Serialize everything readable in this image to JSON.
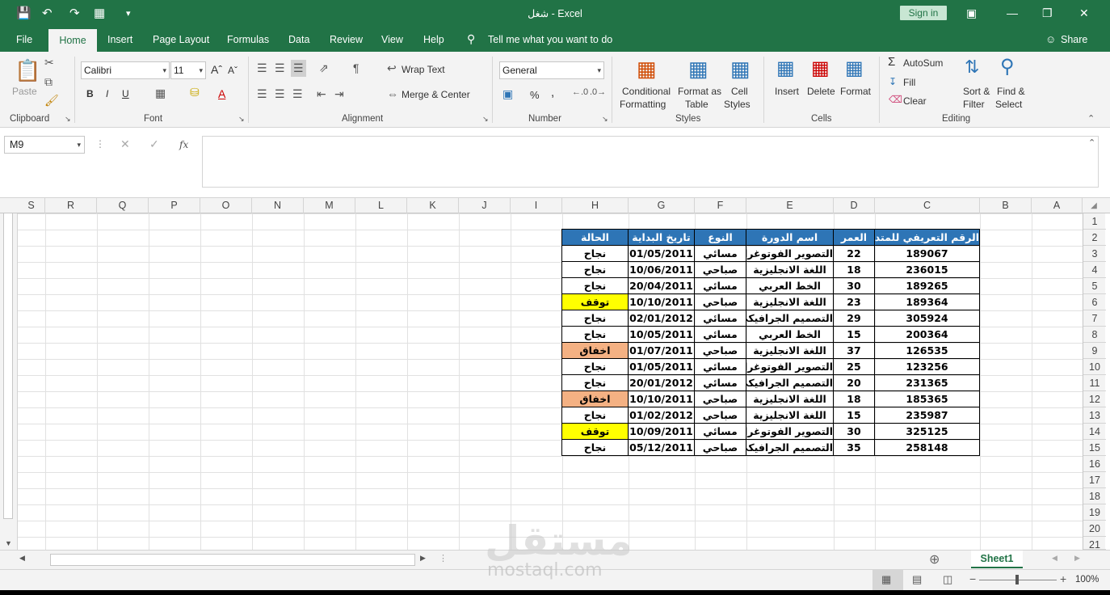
{
  "window": {
    "title": "شغل  -  Excel",
    "sign_in": "Sign in",
    "share": "Share"
  },
  "tabs": [
    "File",
    "Home",
    "Insert",
    "Page Layout",
    "Formulas",
    "Data",
    "Review",
    "View",
    "Help"
  ],
  "tell_me": "Tell me what you want to do",
  "ribbon": {
    "clipboard": {
      "label": "Clipboard",
      "paste": "Paste"
    },
    "font": {
      "label": "Font",
      "name": "Calibri",
      "size": "11",
      "bold": "B",
      "italic": "I",
      "underline": "U"
    },
    "alignment": {
      "label": "Alignment",
      "wrap_text": "Wrap Text",
      "merge_center": "Merge & Center"
    },
    "number": {
      "label": "Number",
      "format": "General",
      "percent": "%",
      "comma": ","
    },
    "styles": {
      "label": "Styles",
      "conditional_1": "Conditional",
      "conditional_2": "Formatting",
      "format_as_1": "Format as",
      "format_as_2": "Table",
      "cell_styles_1": "Cell",
      "cell_styles_2": "Styles"
    },
    "cells": {
      "label": "Cells",
      "insert": "Insert",
      "delete": "Delete",
      "format": "Format"
    },
    "editing": {
      "label": "Editing",
      "autosum": "AutoSum",
      "fill": "Fill",
      "clear": "Clear",
      "sort_1": "Sort &",
      "sort_2": "Filter",
      "find_1": "Find &",
      "find_2": "Select"
    }
  },
  "formula_bar": {
    "name_box": "M9",
    "fx": "fx",
    "value": ""
  },
  "columns": [
    "S",
    "R",
    "Q",
    "P",
    "O",
    "N",
    "M",
    "L",
    "K",
    "J",
    "I",
    "H",
    "G",
    "F",
    "E",
    "D",
    "C",
    "B",
    "A"
  ],
  "rows": [
    "1",
    "2",
    "3",
    "4",
    "5",
    "6",
    "7",
    "8",
    "9",
    "10",
    "11",
    "12",
    "13",
    "14",
    "15",
    "16",
    "17",
    "18",
    "19",
    "20",
    "21"
  ],
  "table": {
    "headers": [
      "الرقم التعريفي للمتدرب",
      "العمر",
      "اسم الدورة",
      "النوع",
      "تاريخ البداية",
      "الحالة"
    ],
    "rows": [
      [
        "189067",
        "22",
        "التصوير الفوتوغرافي",
        "مسائي",
        "01/05/2011",
        "نجاح"
      ],
      [
        "236015",
        "18",
        "اللغة الانجليزية",
        "صباحي",
        "10/06/2011",
        "نجاح"
      ],
      [
        "189265",
        "30",
        "الخط العربي",
        "مسائي",
        "20/04/2011",
        "نجاح"
      ],
      [
        "189364",
        "23",
        "اللغة الانجليزية",
        "صباحي",
        "10/10/2011",
        "توقف"
      ],
      [
        "305924",
        "29",
        "التصميم الجرافيكي",
        "مسائي",
        "02/01/2012",
        "نجاح"
      ],
      [
        "200364",
        "15",
        "الخط العربي",
        "مسائي",
        "10/05/2011",
        "نجاح"
      ],
      [
        "126535",
        "37",
        "اللغة الانجليزية",
        "صباحي",
        "01/07/2011",
        "اخفاق"
      ],
      [
        "123256",
        "25",
        "التصوير الفوتوغرافي",
        "مسائي",
        "01/05/2011",
        "نجاح"
      ],
      [
        "231365",
        "20",
        "التصميم الجرافيكي",
        "مسائي",
        "20/01/2012",
        "نجاح"
      ],
      [
        "185365",
        "18",
        "اللغة الانجليزية",
        "صباحي",
        "10/10/2011",
        "اخفاق"
      ],
      [
        "235987",
        "15",
        "اللغة الانجليزية",
        "صباحي",
        "01/02/2012",
        "نجاح"
      ],
      [
        "325125",
        "30",
        "التصوير الفوتوغرافي",
        "مسائي",
        "10/09/2011",
        "توقف"
      ],
      [
        "258148",
        "35",
        "التصميم الجرافيكي",
        "صباحي",
        "05/12/2011",
        "نجاح"
      ]
    ],
    "status_colors": {
      "توقف": "#ffff00",
      "اخفاق": "#f4b183",
      "نجاح": "#ffffff"
    },
    "header_color": "#2e75b6"
  },
  "sheet": {
    "name": "Sheet1"
  },
  "status": {
    "zoom": "100%"
  },
  "watermark": {
    "arabic": "مستقل",
    "latin": "mostaql.com"
  },
  "colors": {
    "excel_green": "#217346"
  }
}
